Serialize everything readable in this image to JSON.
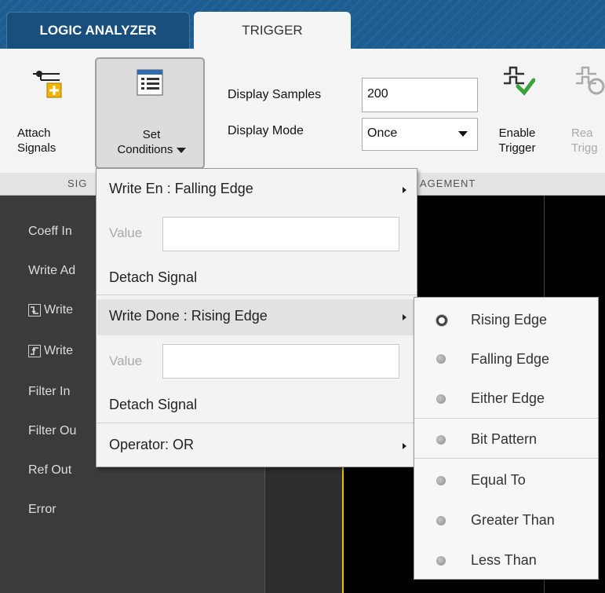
{
  "tabs": [
    {
      "label": "LOGIC ANALYZER",
      "active": false
    },
    {
      "label": "TRIGGER",
      "active": true
    }
  ],
  "toolstrip": {
    "attach_signals": {
      "line1": "Attach",
      "line2": "Signals",
      "icon": "attach-signal-icon"
    },
    "set_conditions": {
      "line1": "Set",
      "line2": "Conditions",
      "icon": "list-icon"
    },
    "display_samples": {
      "label": "Display Samples",
      "value": "200"
    },
    "display_mode": {
      "label": "Display Mode",
      "value": "Once"
    },
    "enable_trigger": {
      "line1": "Enable",
      "line2": "Trigger",
      "icon": "enable-trigger-icon"
    },
    "rearm_trigger": {
      "line1": "Rea",
      "line2": "Trigg",
      "icon": "rearm-trigger-icon"
    },
    "sections": [
      "SIG",
      "AGEMENT"
    ]
  },
  "signals": [
    {
      "label": "Coeff In",
      "edge_icon": false
    },
    {
      "label": "Write Ad",
      "edge_icon": false
    },
    {
      "label": "Write",
      "edge_icon": "falling-edge-icon"
    },
    {
      "label": "Write",
      "edge_icon": "rising-edge-icon"
    },
    {
      "label": "Filter In",
      "edge_icon": false
    },
    {
      "label": "Filter Ou",
      "edge_icon": false
    },
    {
      "label": "Ref Out",
      "edge_icon": false
    },
    {
      "label": "Error",
      "edge_icon": false
    }
  ],
  "conditions_menu": {
    "items": [
      {
        "label": "Write En : Falling Edge",
        "submenu": true
      },
      {
        "value_label": "Value",
        "value": ""
      },
      {
        "label": "Detach Signal"
      },
      {
        "label": "Write Done : Rising Edge",
        "submenu": true,
        "highlighted": true
      },
      {
        "value_label": "Value",
        "value": ""
      },
      {
        "label": "Detach Signal"
      },
      {
        "label": "Operator: OR",
        "submenu": true
      }
    ]
  },
  "edge_menu": {
    "options": [
      {
        "label": "Rising Edge",
        "selected": true
      },
      {
        "label": "Falling Edge",
        "selected": false
      },
      {
        "label": "Either Edge",
        "selected": false
      },
      {
        "label": "Bit Pattern",
        "selected": false
      },
      {
        "label": "Equal To",
        "selected": false
      },
      {
        "label": "Greater Than",
        "selected": false
      },
      {
        "label": "Less Than",
        "selected": false
      }
    ]
  },
  "colors": {
    "tab_strip": "#1d5d92",
    "cursor": "#e5c600",
    "panel": "#3b3b3b"
  }
}
